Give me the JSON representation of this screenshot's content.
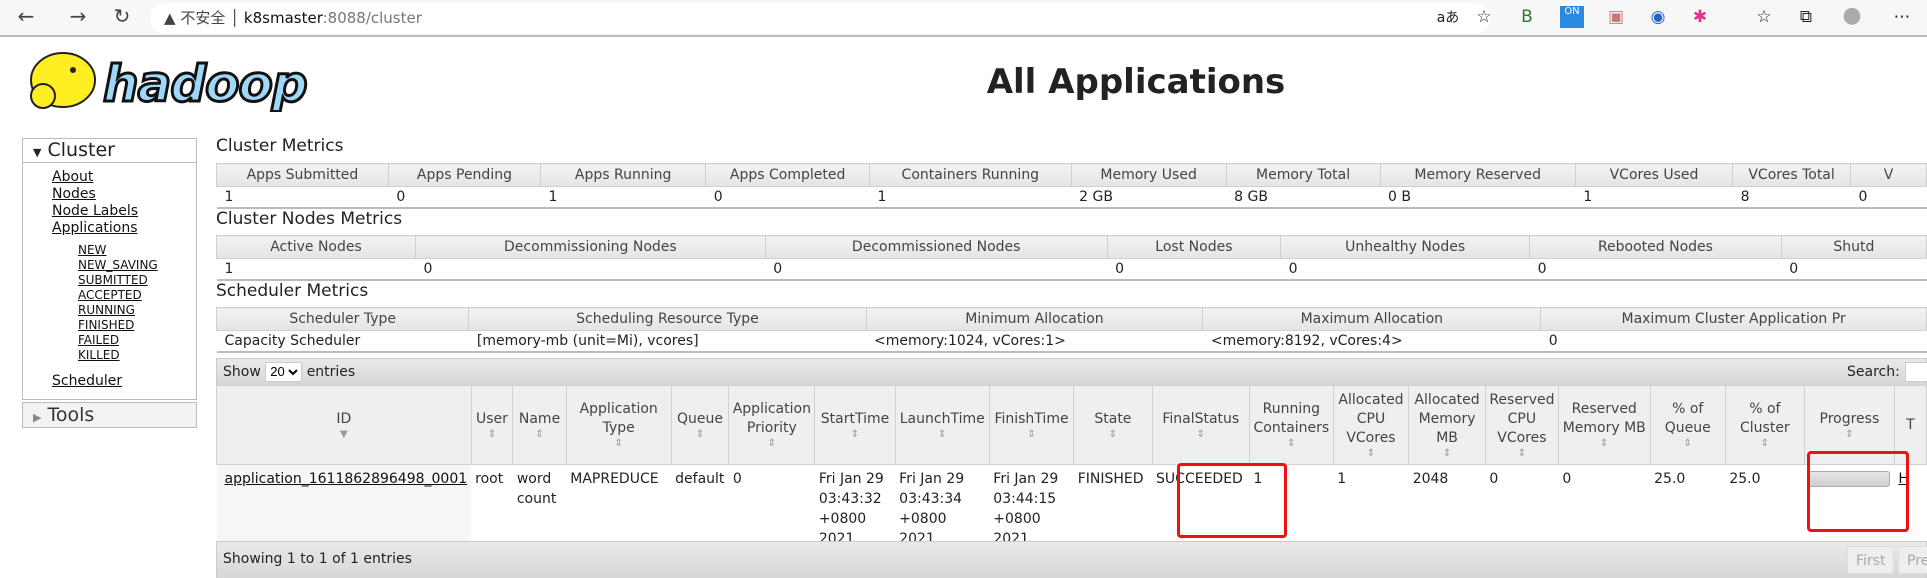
{
  "browser": {
    "warning": "不安全",
    "host": "k8smaster",
    "path": ":8088/cluster",
    "extensions": [
      "aa",
      "star-add",
      "b-ext",
      "on-ext",
      "pdf-ext",
      "blue-ext",
      "color-ext",
      "favorites",
      "collections",
      "profile",
      "more"
    ]
  },
  "page": {
    "title": "All Applications",
    "logo_text": "hadoop"
  },
  "sidebar": {
    "cluster_label": "Cluster",
    "tools_label": "Tools",
    "links": [
      "About",
      "Nodes",
      "Node Labels",
      "Applications"
    ],
    "states": [
      "NEW",
      "NEW_SAVING",
      "SUBMITTED",
      "ACCEPTED",
      "RUNNING",
      "FINISHED",
      "FAILED",
      "KILLED"
    ],
    "scheduler": "Scheduler"
  },
  "cluster_metrics": {
    "title": "Cluster Metrics",
    "headers": [
      "Apps Submitted",
      "Apps Pending",
      "Apps Running",
      "Apps Completed",
      "Containers Running",
      "Memory Used",
      "Memory Total",
      "Memory Reserved",
      "VCores Used",
      "VCores Total",
      "V"
    ],
    "values": [
      "1",
      "0",
      "1",
      "0",
      "1",
      "2 GB",
      "8 GB",
      "0 B",
      "1",
      "8",
      "0"
    ]
  },
  "nodes_metrics": {
    "title": "Cluster Nodes Metrics",
    "headers": [
      "Active Nodes",
      "Decommissioning Nodes",
      "Decommissioned Nodes",
      "Lost Nodes",
      "Unhealthy Nodes",
      "Rebooted Nodes",
      "Shutd"
    ],
    "values": [
      "1",
      "0",
      "0",
      "0",
      "0",
      "0",
      "0"
    ]
  },
  "scheduler_metrics": {
    "title": "Scheduler Metrics",
    "headers": [
      "Scheduler Type",
      "Scheduling Resource Type",
      "Minimum Allocation",
      "Maximum Allocation",
      "Maximum Cluster Application Pr"
    ],
    "values": [
      "Capacity Scheduler",
      "[memory-mb (unit=Mi), vcores]",
      "<memory:1024, vCores:1>",
      "<memory:8192, vCores:4>",
      "0"
    ]
  },
  "apps": {
    "show_label": "Show",
    "entries_label": "entries",
    "page_size": "20",
    "search_label": "Search:",
    "headers": [
      "ID",
      "User",
      "Name",
      "Application Type",
      "Queue",
      "Application Priority",
      "StartTime",
      "LaunchTime",
      "FinishTime",
      "State",
      "FinalStatus",
      "Running Containers",
      "Allocated CPU VCores",
      "Allocated Memory MB",
      "Reserved CPU VCores",
      "Reserved Memory MB",
      "% of Queue",
      "% of Cluster",
      "Progress",
      "T"
    ],
    "rows": [
      {
        "id": "application_1611862896498_0001",
        "user": "root",
        "name": "word count",
        "type": "MAPREDUCE",
        "queue": "default",
        "priority": "0",
        "start": "Fri Jan 29 03:43:32 +0800 2021",
        "launch": "Fri Jan 29 03:43:34 +0800 2021",
        "finish": "Fri Jan 29 03:44:15 +0800 2021",
        "state": "FINISHED",
        "final_status": "SUCCEEDED",
        "running_containers": "1",
        "alloc_vcores": "1",
        "alloc_mem": "2048",
        "res_vcores": "0",
        "res_mem": "0",
        "pct_queue": "25.0",
        "pct_cluster": "25.0",
        "progress": 100,
        "tracking": "H"
      }
    ],
    "footer": "Showing 1 to 1 of 1 entries",
    "pager": [
      "First",
      "Previ"
    ]
  },
  "highlight_color": "#f01010"
}
